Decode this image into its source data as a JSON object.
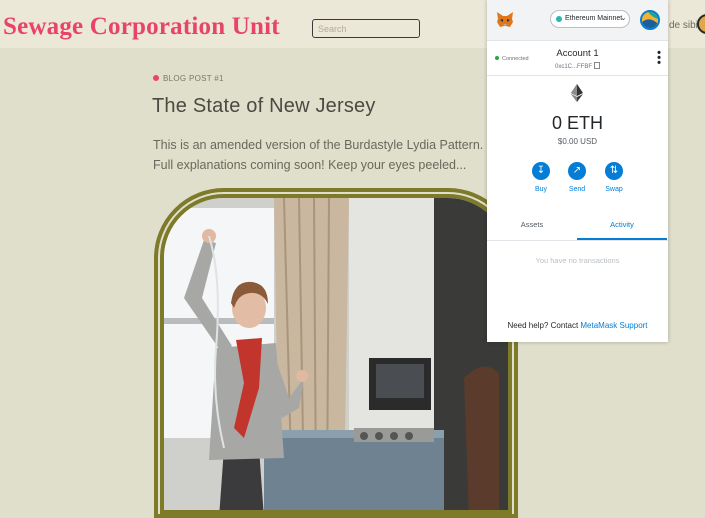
{
  "site": {
    "title": "Sewage Corporation Unit",
    "search_placeholder": "Search",
    "nav_peek": "de sibi"
  },
  "post": {
    "meta": "Blog Post #1",
    "title": "The State of New Jersey",
    "excerpt": "This is an amended version of the Burdastyle Lydia Pattern. Full explanations coming soon! Keep your eyes peeled..."
  },
  "metamask": {
    "network": "Ethereum Mainnet",
    "connected_label": "Connected",
    "account_name": "Account 1",
    "account_address": "0xc1C...FFBF",
    "balance": "0 ETH",
    "balance_usd": "$0.00 USD",
    "actions": {
      "buy": "Buy",
      "send": "Send",
      "swap": "Swap"
    },
    "tabs": {
      "assets": "Assets",
      "activity": "Activity"
    },
    "empty_state": "You have no transactions",
    "help_prefix": "Need help? Contact ",
    "help_link": "MetaMask Support"
  },
  "colors": {
    "brand_pink": "#e8436b",
    "frame_olive": "#7d7a2a",
    "metamask_blue": "#037dd6",
    "page_bg": "#e0dfcc"
  },
  "icons": [
    "fox-icon",
    "ethereum-icon",
    "download-icon",
    "send-arrow-icon",
    "swap-icon",
    "copy-icon",
    "kebab-menu-icon",
    "chevron-down-icon"
  ]
}
